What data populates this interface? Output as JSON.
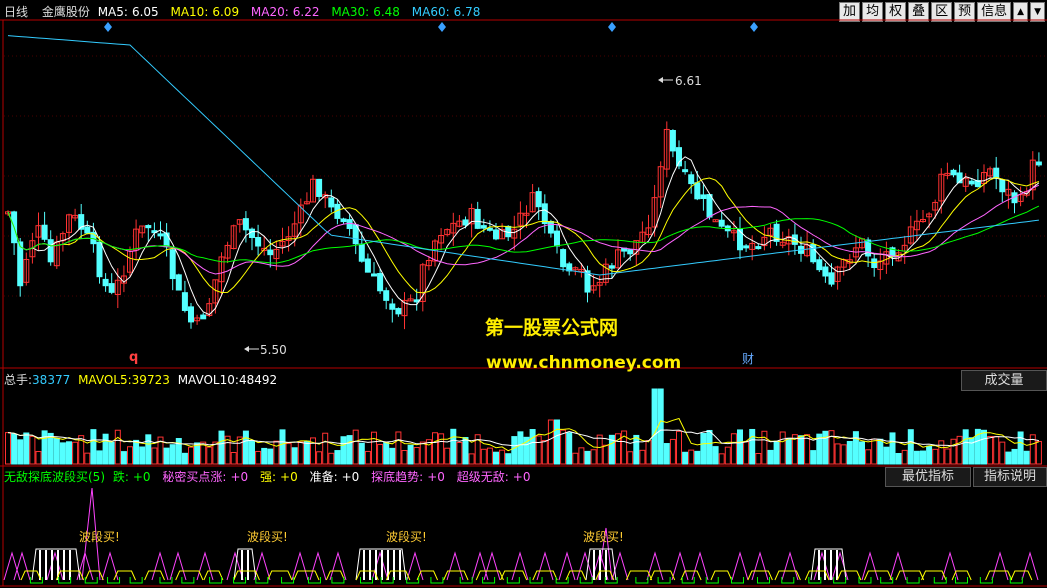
{
  "header": {
    "period": "日线",
    "stock": "金鹰股份",
    "ma5": {
      "label": "MA5:",
      "value": "6.05",
      "color": "#ffffff"
    },
    "ma10": {
      "label": "MA10:",
      "value": "6.09",
      "color": "#ffff00"
    },
    "ma20": {
      "label": "MA20:",
      "value": "6.22",
      "color": "#ff66ff"
    },
    "ma30": {
      "label": "MA30:",
      "value": "6.48",
      "color": "#00ff00"
    },
    "ma60": {
      "label": "MA60:",
      "value": "6.78",
      "color": "#33ccff"
    }
  },
  "toolbar": {
    "buttons": [
      "加",
      "均",
      "权",
      "叠",
      "区",
      "预",
      "信息",
      "▲",
      "▼"
    ]
  },
  "price_panel": {
    "high_label": "6.61",
    "low_label": "5.50",
    "marker_q": "q",
    "marker_cai": "财",
    "watermark_title": "第一股票公式网",
    "watermark_url": "www.chnmoney.com"
  },
  "volume_panel": {
    "total_label": "总手:",
    "total_value": "38377",
    "mavol5_label": "MAVOL5:",
    "mavol5_value": "39723",
    "mavol10_label": "MAVOL10:",
    "mavol10_value": "48492",
    "button": "成交量"
  },
  "indicator_panel": {
    "name": "无敌探底波段买(5)",
    "fields": [
      {
        "label": "跌:",
        "value": "+0",
        "color": "#00ff00"
      },
      {
        "label": "秘密买点涨:",
        "value": "+0",
        "color": "#ff66ff"
      },
      {
        "label": "强:",
        "value": "+0",
        "color": "#ffff00"
      },
      {
        "label": "准备:",
        "value": "+0",
        "color": "#ffffff"
      },
      {
        "label": "探底趋势:",
        "value": "+0",
        "color": "#ff66ff"
      },
      {
        "label": "超级无敌:",
        "value": "+0",
        "color": "#ff66ff"
      }
    ],
    "buttons": [
      "最优指标",
      "指标说明"
    ],
    "signal_labels": [
      "波段买!",
      "波段买!",
      "波段买!",
      "波段买!"
    ]
  },
  "colors": {
    "up": "#ff3232",
    "down": "#54ffff",
    "axis": "#b40000"
  },
  "chart_data": {
    "type": "candlestick",
    "price_range": [
      5.3,
      6.8
    ],
    "price_high": 6.61,
    "price_low": 5.5,
    "ma_lines": [
      {
        "name": "MA5",
        "last": 6.05
      },
      {
        "name": "MA10",
        "last": 6.09
      },
      {
        "name": "MA20",
        "last": 6.22
      },
      {
        "name": "MA30",
        "last": 6.48
      },
      {
        "name": "MA60",
        "last": 6.78
      }
    ],
    "volume": {
      "total": 38377,
      "mavol5": 39723,
      "mavol10": 48492
    }
  }
}
